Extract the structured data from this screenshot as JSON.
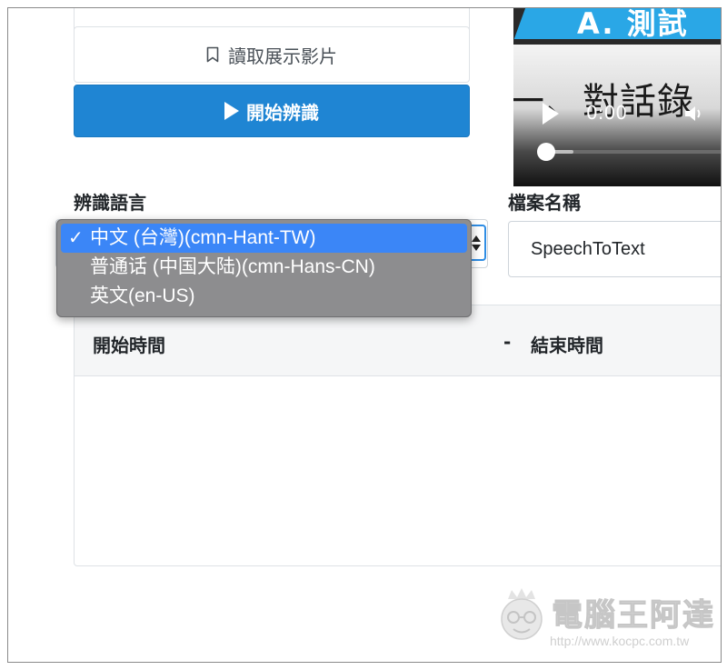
{
  "load_button": {
    "label": "讀取展示影片",
    "icon": "bookmark-icon"
  },
  "start_button": {
    "label": "開始辨識",
    "icon": "play-icon",
    "color": "#1f85d3"
  },
  "video": {
    "banner_text": "A. 測試",
    "caption_text": "一、對話錄",
    "time": "0:00",
    "progress_fraction": 0.05
  },
  "language": {
    "label": "辨識語言",
    "options": [
      {
        "label": "中文 (台灣)(cmn-Hant-TW)",
        "selected": true
      },
      {
        "label": "普通话 (中国大陆)(cmn-Hans-CN)",
        "selected": false
      },
      {
        "label": "英文(en-US)",
        "selected": false
      }
    ],
    "selected_color": "#3b86f7"
  },
  "file_name": {
    "label": "檔案名稱",
    "value": "SpeechToText"
  },
  "table": {
    "start_header": "開始時間",
    "separator": "-",
    "end_header": "結束時間"
  },
  "watermark": {
    "title": "電腦王阿達",
    "url": "http://www.kocpc.com.tw"
  }
}
